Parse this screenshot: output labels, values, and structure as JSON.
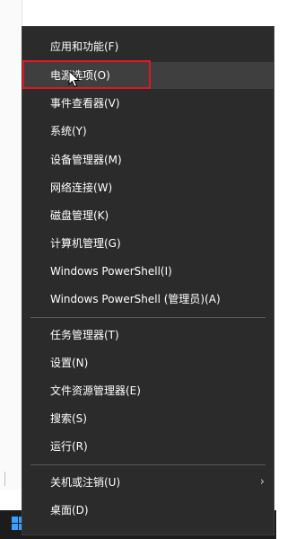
{
  "menu": {
    "items": [
      {
        "label": "应用和功能(F)"
      },
      {
        "label": "电源选项(O)"
      },
      {
        "label": "事件查看器(V)"
      },
      {
        "label": "系统(Y)"
      },
      {
        "label": "设备管理器(M)"
      },
      {
        "label": "网络连接(W)"
      },
      {
        "label": "磁盘管理(K)"
      },
      {
        "label": "计算机管理(G)"
      },
      {
        "label": "Windows PowerShell(I)"
      },
      {
        "label": "Windows PowerShell (管理员)(A)"
      },
      {
        "label": "任务管理器(T)"
      },
      {
        "label": "设置(N)"
      },
      {
        "label": "文件资源管理器(E)"
      },
      {
        "label": "搜索(S)"
      },
      {
        "label": "运行(R)"
      },
      {
        "label": "关机或注销(U)",
        "submenu": true
      },
      {
        "label": "桌面(D)"
      }
    ],
    "selected_label": "电源选项(O)",
    "submenu_glyph": "›"
  },
  "colors": {
    "menu_background": "#2b2b2b",
    "menu_text": "#ffffff",
    "selected_background": "#3f3f3f",
    "highlight_outline": "#e0181e",
    "taskbar": "#1c1c1c",
    "start_icon": "#3aa0ff"
  },
  "icons": {
    "pointer": "mouse-pointer-icon",
    "start": "windows-start-icon",
    "submenu": "chevron-right-icon"
  }
}
